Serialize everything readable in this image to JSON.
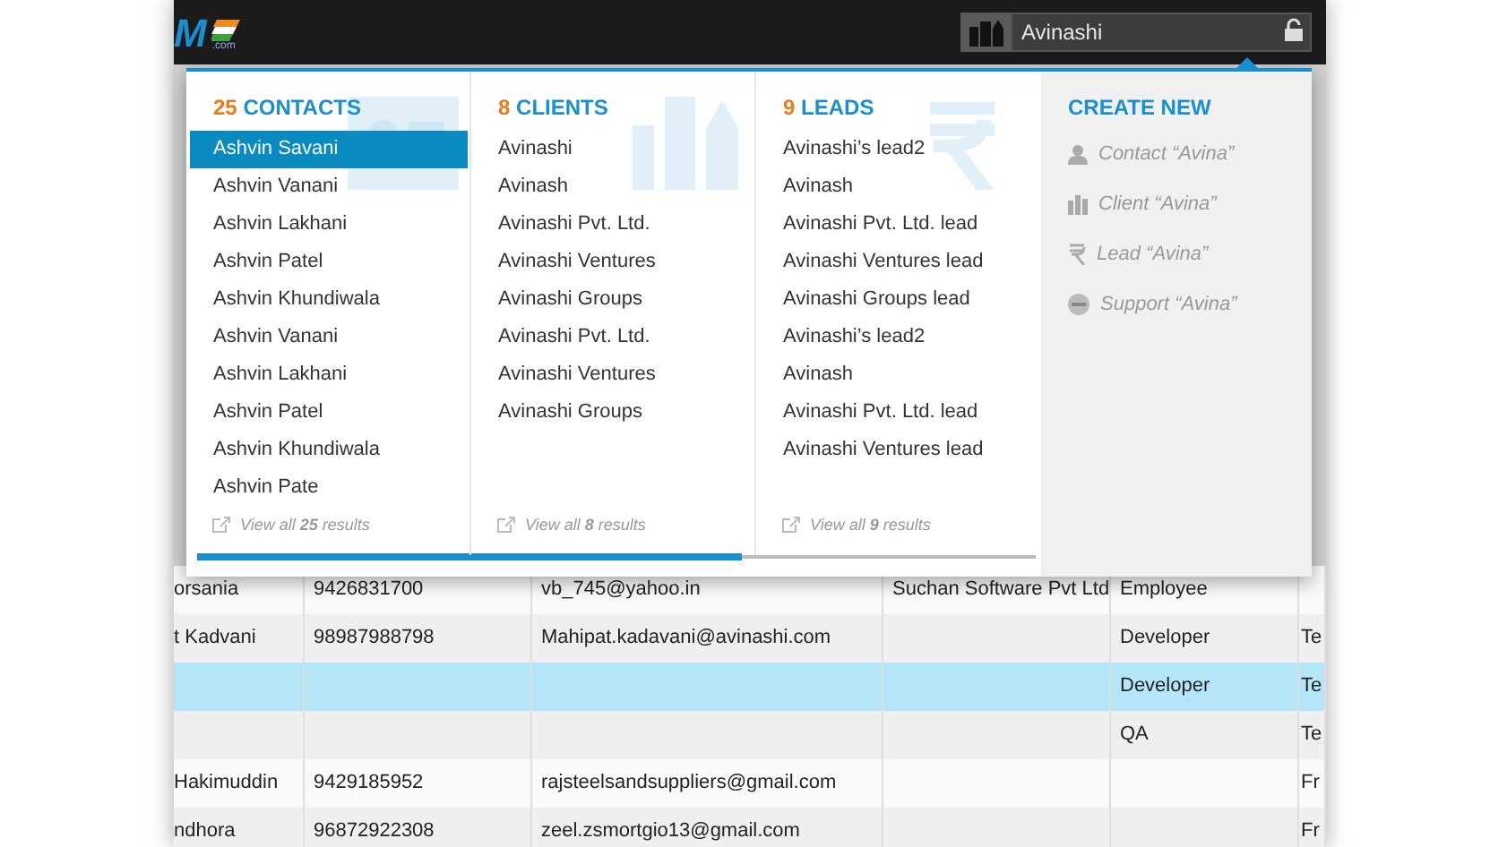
{
  "logo": {
    "text": "M",
    "suffix": ".com"
  },
  "search": {
    "value": "Avinashi"
  },
  "results": [
    {
      "kind": "contacts",
      "count": "25",
      "title": "CONTACTS",
      "footer": "View all **25** results",
      "items": [
        {
          "label": "Ashvin Savani",
          "selected": true
        },
        {
          "label": "Ashvin Vanani",
          "selected": false
        },
        {
          "label": "Ashvin Lakhani",
          "selected": false
        },
        {
          "label": "Ashvin Patel",
          "selected": false
        },
        {
          "label": "Ashvin Khundiwala",
          "selected": false
        },
        {
          "label": "Ashvin Vanani",
          "selected": false
        },
        {
          "label": "Ashvin Lakhani",
          "selected": false
        },
        {
          "label": "Ashvin Patel",
          "selected": false
        },
        {
          "label": "Ashvin Khundiwala",
          "selected": false
        },
        {
          "label": "Ashvin Pate",
          "selected": false
        }
      ]
    },
    {
      "kind": "clients",
      "count": "8",
      "title": "CLIENTS",
      "footer": "View all **8** results",
      "items": [
        {
          "label": "Avinashi",
          "selected": false
        },
        {
          "label": "Avinash",
          "selected": false
        },
        {
          "label": "Avinashi Pvt. Ltd.",
          "selected": false
        },
        {
          "label": "Avinashi Ventures",
          "selected": false
        },
        {
          "label": "Avinashi Groups",
          "selected": false
        },
        {
          "label": "Avinashi Pvt. Ltd.",
          "selected": false
        },
        {
          "label": "Avinashi Ventures",
          "selected": false
        },
        {
          "label": "Avinashi Groups",
          "selected": false
        }
      ]
    },
    {
      "kind": "leads",
      "count": "9",
      "title": "LEADS",
      "footer": "View all **9** results",
      "items": [
        {
          "label": "Avinashi’s lead2",
          "selected": false
        },
        {
          "label": "Avinash",
          "selected": false
        },
        {
          "label": "Avinashi Pvt. Ltd. lead",
          "selected": false
        },
        {
          "label": "Avinashi Ventures lead",
          "selected": false
        },
        {
          "label": "Avinashi Groups lead",
          "selected": false
        },
        {
          "label": "Avinashi’s lead2",
          "selected": false
        },
        {
          "label": "Avinash",
          "selected": false
        },
        {
          "label": "Avinashi Pvt. Ltd. lead",
          "selected": false
        },
        {
          "label": "Avinashi Ventures lead",
          "selected": false
        }
      ]
    }
  ],
  "create_new": {
    "title": "CREATE NEW",
    "items": [
      {
        "kind": "contact",
        "label": "Contact “Avina”"
      },
      {
        "kind": "client",
        "label": "Client “Avina”"
      },
      {
        "kind": "lead",
        "label": "Lead “Avina”"
      },
      {
        "kind": "support",
        "label": "Support “Avina”"
      }
    ]
  },
  "table": {
    "rows": [
      {
        "selected": false,
        "cells": [
          "orsania",
          "9426831700",
          "vb_745@yahoo.in",
          "Suchan Software Pvt Ltd",
          "Employee",
          ""
        ]
      },
      {
        "selected": false,
        "cells": [
          "t Kadvani",
          "98987988798",
          "Mahipat.kadavani@avinashi.com",
          "",
          "Developer",
          "Te"
        ]
      },
      {
        "selected": true,
        "cells": [
          "",
          "",
          "",
          "",
          "Developer",
          "Te"
        ]
      },
      {
        "selected": false,
        "cells": [
          "",
          "",
          "",
          "",
          "QA",
          "Te"
        ]
      },
      {
        "selected": false,
        "cells": [
          "Hakimuddin",
          "9429185952",
          "rajsteelsandsuppliers@gmail.com",
          "",
          "",
          "Fr"
        ]
      },
      {
        "selected": false,
        "cells": [
          "ndhora",
          "96872922308",
          "zeel.zsmortgio13@gmail.com",
          "",
          "",
          "Fr"
        ]
      }
    ]
  }
}
